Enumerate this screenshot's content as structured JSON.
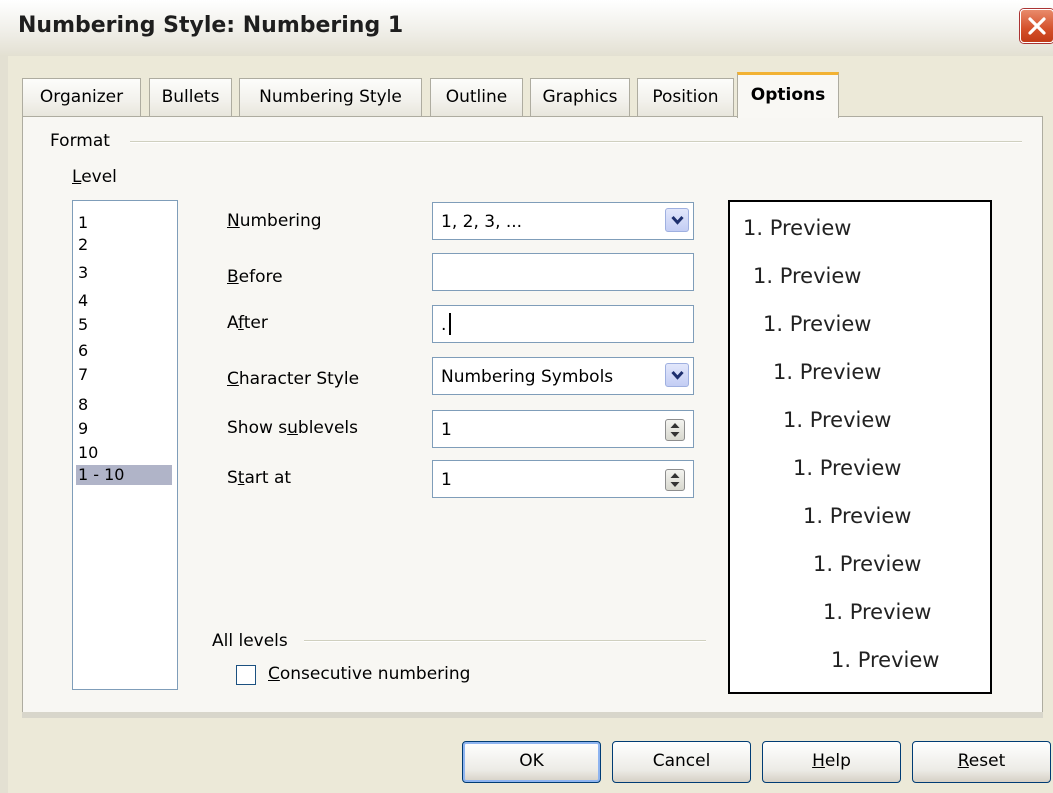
{
  "window": {
    "title": "Numbering Style: Numbering 1"
  },
  "tabs": [
    {
      "label": "Organizer",
      "active": false
    },
    {
      "label": "Bullets",
      "active": false
    },
    {
      "label": "Numbering Style",
      "active": false
    },
    {
      "label": "Outline",
      "active": false
    },
    {
      "label": "Graphics",
      "active": false
    },
    {
      "label": "Position",
      "active": false
    },
    {
      "label": "Options",
      "active": true
    }
  ],
  "format": {
    "section_label": "Format",
    "level_label": "Level",
    "levels": [
      "1",
      "2",
      "3",
      "4",
      "5",
      "6",
      "7",
      "8",
      "9",
      "10",
      "1 - 10"
    ],
    "selected_level": "1 - 10"
  },
  "fields": {
    "numbering": {
      "label": "Numbering",
      "value": "1, 2, 3, ..."
    },
    "before": {
      "label": "Before",
      "value": ""
    },
    "after": {
      "label": "After",
      "value": "."
    },
    "character_style": {
      "label": "Character Style",
      "value": "Numbering Symbols"
    },
    "show_sublevels": {
      "label": "Show sublevels",
      "value": "1"
    },
    "start_at": {
      "label": "Start at",
      "value": "1"
    }
  },
  "all_levels": {
    "section_label": "All levels",
    "consecutive_numbering": {
      "label": "Consecutive numbering",
      "checked": false
    }
  },
  "preview": {
    "lines": [
      "1. Preview",
      "1. Preview",
      "1. Preview",
      "1. Preview",
      "1. Preview",
      "1. Preview",
      "1. Preview",
      "1. Preview",
      "1. Preview",
      "1. Preview"
    ]
  },
  "buttons": {
    "ok": "OK",
    "cancel": "Cancel",
    "help": "Help",
    "reset": "Reset"
  },
  "icons": {
    "close": "close-icon",
    "dropdown": "chevron-down-icon",
    "spinner": "spin-updown-icon"
  },
  "colors": {
    "active_tab_accent": "#f2b233",
    "close_button": "#d4502a",
    "selection": "#b0b4c8"
  }
}
